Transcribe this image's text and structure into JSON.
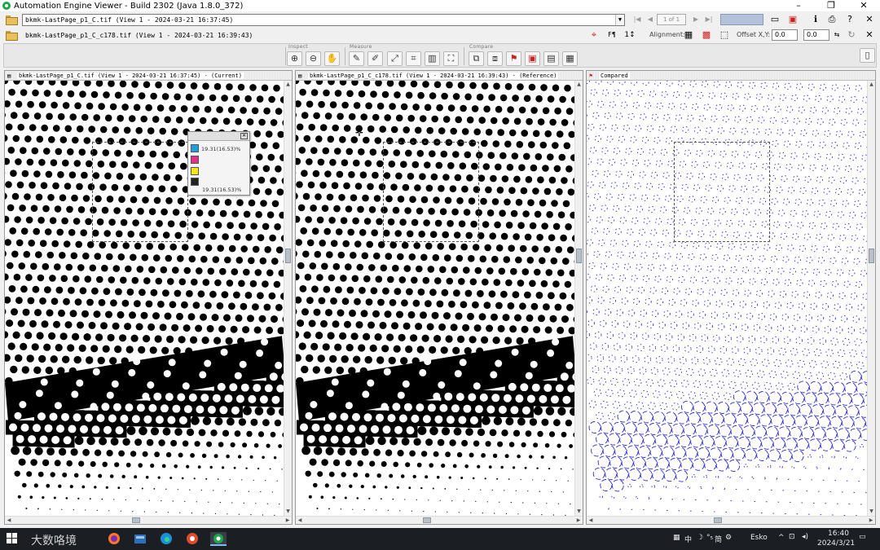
{
  "window": {
    "title": "Automation Engine Viewer - Build 2302 (Java 1.8.0_372)",
    "controls": [
      "–",
      "❐",
      "✕"
    ]
  },
  "files": {
    "current": "bkmk-LastPage_p1_C.tif  (View 1 - 2024-03-21  16:37:45)",
    "reference": "bkmk-LastPage_p1_C_c178.tif  (View 1 - 2024-03-21  16:39:43)"
  },
  "paging": {
    "page_text": "1 of 1"
  },
  "alignment": {
    "label": "Alignment:",
    "offset_label": "Offset X,Y:",
    "offset_x": "0.0",
    "offset_y": "0.0"
  },
  "toolbar": {
    "groups": [
      {
        "label": "Inspect",
        "tools": [
          "zoom-in",
          "zoom-out",
          "pan"
        ]
      },
      {
        "label": "Measure",
        "tools": [
          "ruler",
          "eyedropper-dense",
          "eyedropper",
          "densitometer",
          "grid-measure",
          "grid-crop"
        ]
      },
      {
        "label": "Compare",
        "tools": [
          "compare-a",
          "compare-b",
          "compare-flag",
          "compare-c",
          "compare-d",
          "compare-e"
        ]
      }
    ]
  },
  "panels": {
    "current": {
      "title": "bkmk-LastPage_p1_C.tif (View 1 - 2024-03-21 16:37:45) - (Current)"
    },
    "reference": {
      "title": "bkmk-LastPage_p1_C_c178.tif (View 1 - 2024-03-21 16:39:43) - (Reference)"
    },
    "compared": {
      "title": "Compared"
    }
  },
  "densitometer": {
    "values": [
      {
        "color": "#1ea0dc",
        "text": "19.31(16.53)%"
      },
      {
        "color": "#e0308a",
        "text": ""
      },
      {
        "color": "#f5e61e",
        "text": ""
      },
      {
        "color": "#222222",
        "text": "19.31(16.53)%"
      }
    ]
  },
  "taskbar": {
    "watermark": "大数咯境",
    "ime": "中",
    "ime2": "简",
    "user": "Esko",
    "time": "16:40",
    "date": "2024/3/21"
  }
}
